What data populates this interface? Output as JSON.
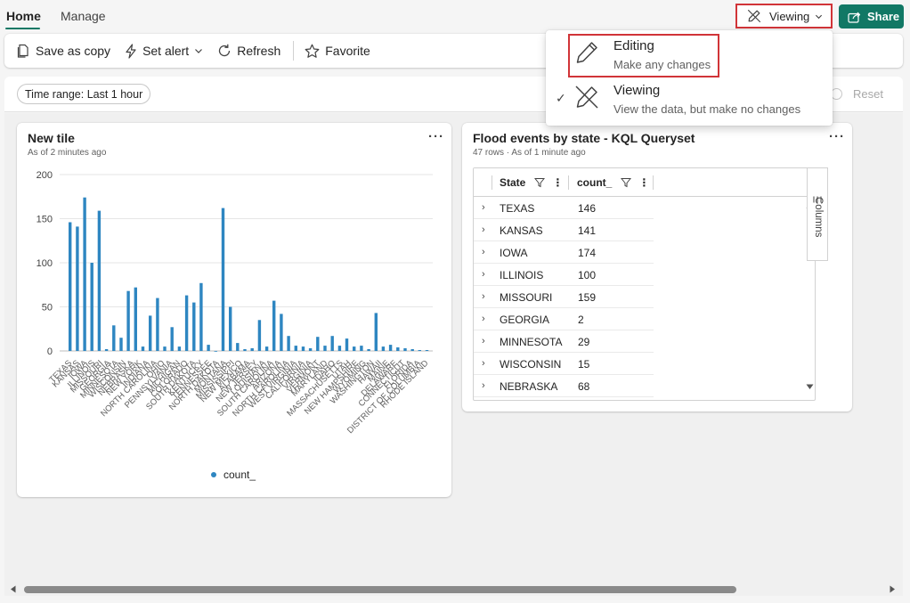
{
  "tabs": [
    {
      "label": "Home",
      "active": true
    },
    {
      "label": "Manage",
      "active": false
    }
  ],
  "header": {
    "mode_label": "Viewing",
    "share_label": "Share"
  },
  "toolbar": {
    "save_copy": "Save as copy",
    "set_alert": "Set alert",
    "refresh": "Refresh",
    "favorite": "Favorite"
  },
  "time_range": "Time range: Last 1 hour",
  "reset_label": "Reset",
  "mode_menu": {
    "items": [
      {
        "title": "Editing",
        "desc": "Make any changes",
        "icon": "pencil-icon",
        "checked": false
      },
      {
        "title": "Viewing",
        "desc": "View the data, but make no changes",
        "icon": "pencil-off-icon",
        "checked": true
      }
    ]
  },
  "tile1": {
    "title": "New tile",
    "subtitle": "As of 2 minutes ago",
    "more": "···"
  },
  "tile2": {
    "title": "Flood events by state - KQL Queryset",
    "subtitle": "47 rows · As of 1 minute ago",
    "more": "···",
    "columns": [
      "State",
      "count_"
    ],
    "rows": [
      {
        "state": "TEXAS",
        "count": "146"
      },
      {
        "state": "KANSAS",
        "count": "141"
      },
      {
        "state": "IOWA",
        "count": "174"
      },
      {
        "state": "ILLINOIS",
        "count": "100"
      },
      {
        "state": "MISSOURI",
        "count": "159"
      },
      {
        "state": "GEORGIA",
        "count": "2"
      },
      {
        "state": "MINNESOTA",
        "count": "29"
      },
      {
        "state": "WISCONSIN",
        "count": "15"
      },
      {
        "state": "NEBRASKA",
        "count": "68"
      }
    ],
    "side_panel_label": "Columns"
  },
  "colors": {
    "accent": "#117865",
    "bar": "#2e86c1",
    "highlight_border": "#d13438"
  },
  "chart_data": {
    "type": "bar",
    "title": "",
    "xlabel": "",
    "ylabel": "",
    "ylim": [
      0,
      200
    ],
    "yticks": [
      0,
      50,
      100,
      150,
      200
    ],
    "grid": true,
    "legend_position": "bottom",
    "categories": [
      "TEXAS",
      "KANSAS",
      "IOWA",
      "ILLINOIS",
      "MISSOURI",
      "GEORGIA",
      "MINNESOTA",
      "WISCONSIN",
      "NEBRASKA",
      "NEW YORK",
      "INDIANA",
      "NORTH CAROLINA",
      "OHIO",
      "PENNSYLVANIA",
      "MICHIGAN",
      "COLORADO",
      "OKLAHOMA",
      "SOUTH DAKOTA",
      "ARKANSAS",
      "KENTUCKY",
      "TENNESSEE",
      "NORTH DAKOTA",
      "MONTANA",
      "MISSISSIPPI",
      "NEW MEXICO",
      "ALABAMA",
      "NEW JERSEY",
      "LOUISIANA",
      "SOUTH CAROLINA",
      "ARIZONA",
      "NORTH CAROLINA 2",
      "VIRGINIA",
      "WEST VIRGINIA",
      "CALIFORNIA",
      "VERMONT",
      "MARYLAND",
      "IDAHO",
      "MASSACHUSETTS",
      "UTAH",
      "OREGON",
      "NEW HAMPSHIRE",
      "WYOMING",
      "WASHINGTON",
      "HAWAII",
      "MAINE",
      "DELAWARE",
      "CONNECTICUT",
      "FLORIDA",
      "DISTRICT OF COLUMBIA",
      "RHODE ISLAND"
    ],
    "x_tick_labels": [
      "TEXAS",
      "KANSAS",
      "IOWA",
      "ILLINOIS",
      "MISSOURI",
      "GEORGIA",
      "MINNESOTA",
      "WISCONSIN",
      "NEBRASKA",
      "NEW YORK",
      "INDIANA",
      "NORTH CAROLINA",
      "OHIO",
      "PENNSYLVANIA",
      "MICHIGAN",
      "COLORADO",
      "SOUTH DAKOTA",
      "KENTUCKY",
      "TENNESSEE",
      "NORTH DAKOTA",
      "MONTANA",
      "MISSISSIPPI",
      "NEW MEXICO",
      "ALABAMA",
      "NEW JERSEY",
      "LOUISIANA",
      "SOUTH CAROLINA",
      "ARIZONA",
      "NORTH CAROLINA",
      "WEST VIRGINIA",
      "CALIFORNIA",
      "VIRGINIA",
      "VERMONT",
      "MARYLAND",
      "IDAHO",
      "MASSACHUSETTS",
      "UTAH",
      "NEW HAMPSHIRE",
      "WYOMING",
      "WASHINGTON",
      "HAWAII",
      "MAINE",
      "DELAWARE",
      "CONNECTICUT",
      "FLORIDA",
      "DISTRICT OF COLUMBIA",
      "RHODE ISLAND"
    ],
    "series": [
      {
        "name": "count_",
        "values": [
          146,
          141,
          174,
          100,
          159,
          2,
          29,
          15,
          68,
          72,
          5,
          40,
          60,
          5,
          27,
          5,
          63,
          55,
          77,
          7,
          0,
          162,
          50,
          9,
          2,
          3,
          35,
          5,
          57,
          42,
          17,
          6,
          5,
          3,
          16,
          6,
          17,
          6,
          14,
          5,
          6,
          2,
          43,
          5,
          7,
          4,
          3,
          2,
          1,
          1
        ]
      }
    ]
  }
}
